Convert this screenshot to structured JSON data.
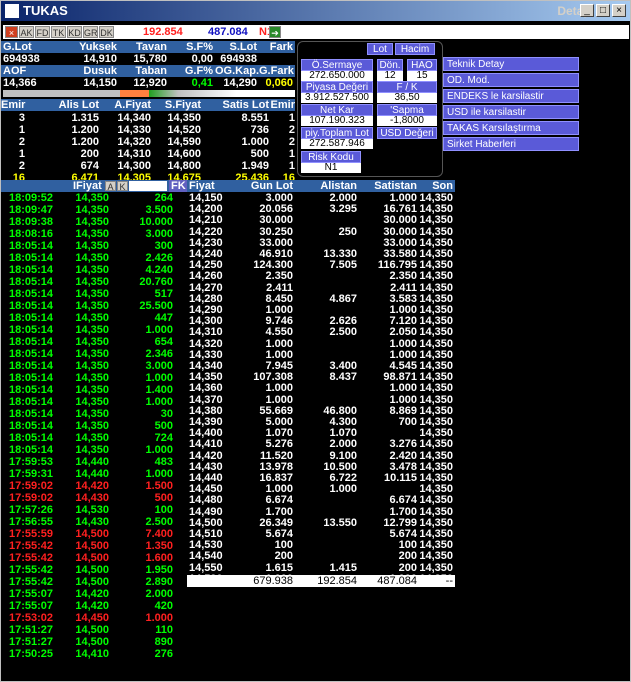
{
  "title": "TUKAS",
  "detay": "Detay",
  "toolbar": {
    "buttons": [
      "AK",
      "FD",
      "TK",
      "KD",
      "GR",
      "DK"
    ],
    "val1": "192.854",
    "val2": "487.084",
    "n1": "N1"
  },
  "summary": {
    "headers1": [
      "G.Lot",
      "Yuksek",
      "Tavan",
      "S.F%",
      "S.Lot",
      "Fark"
    ],
    "values1": [
      "694938",
      "14,910",
      "15,780",
      "0,00",
      "694938",
      ""
    ],
    "headers2": [
      "AOF",
      "Dusuk",
      "Taban",
      "G.F%",
      "OG.Kap.",
      "G.Fark"
    ],
    "values2": [
      "14,366",
      "14,150",
      "12,920",
      "0,41",
      "14,290",
      "0,060"
    ]
  },
  "depth": {
    "headers": [
      "Emir",
      "Alis Lot",
      "A.Fiyat",
      "S.Fiyat",
      "Satis Lot",
      "Emir"
    ],
    "rows": [
      [
        "3",
        "1.315",
        "14,340",
        "14,350",
        "8.551",
        "1"
      ],
      [
        "1",
        "1.200",
        "14,330",
        "14,520",
        "736",
        "2"
      ],
      [
        "2",
        "1.200",
        "14,320",
        "14,590",
        "1.000",
        "2"
      ],
      [
        "1",
        "200",
        "14,310",
        "14,600",
        "500",
        "1"
      ],
      [
        "2",
        "674",
        "14,300",
        "14,800",
        "1.949",
        "1"
      ]
    ],
    "totals": [
      "16",
      "6.471",
      "14,305",
      "14,675",
      "25.436",
      "16"
    ]
  },
  "panel": {
    "lot": "Lot",
    "hacim": "Hacim",
    "osermaye": "Ö.Sermaye",
    "osermaye_v": "272.650.000",
    "don": "Dön.",
    "don_v": "12",
    "hao": "HAO",
    "hao_v": "15",
    "piyasa": "Piyasa Değeri",
    "piyasa_v": "3.912.527.500",
    "fk": "F / K",
    "fk_v": "36,50",
    "netkar": "Net Kar",
    "netkar_v": "107.190.323",
    "sapma": "'Sapma",
    "sapma_v": "-1,8000",
    "piy": "piy.Toplam Lot",
    "piy_v": "272.587.946",
    "usd": "USD Değeri",
    "risk": "Risk Kodu",
    "risk_v": "N1"
  },
  "right_buttons": [
    "Teknik Detay",
    "OD. Mod.",
    "ENDEKS le karsilastir",
    "USD ile karsilastir",
    "TAKAS Karsılaştırma",
    "Sirket Haberleri"
  ],
  "trades": {
    "header": "IFiyat",
    "fk": "FK",
    "rows": [
      [
        "18:09:52",
        "14,350",
        "264",
        "g"
      ],
      [
        "18:09:47",
        "14,350",
        "3.500",
        "g"
      ],
      [
        "18:09:38",
        "14,350",
        "10.000",
        "g"
      ],
      [
        "18:08:16",
        "14,350",
        "3.000",
        "g"
      ],
      [
        "18:05:14",
        "14,350",
        "300",
        "g"
      ],
      [
        "18:05:14",
        "14,350",
        "2.426",
        "g"
      ],
      [
        "18:05:14",
        "14,350",
        "4.240",
        "g"
      ],
      [
        "18:05:14",
        "14,350",
        "20.760",
        "g"
      ],
      [
        "18:05:14",
        "14,350",
        "517",
        "g"
      ],
      [
        "18:05:14",
        "14,350",
        "25.500",
        "g"
      ],
      [
        "18:05:14",
        "14,350",
        "447",
        "g"
      ],
      [
        "18:05:14",
        "14,350",
        "1.000",
        "g"
      ],
      [
        "18:05:14",
        "14,350",
        "654",
        "g"
      ],
      [
        "18:05:14",
        "14,350",
        "2.346",
        "g"
      ],
      [
        "18:05:14",
        "14,350",
        "3.000",
        "g"
      ],
      [
        "18:05:14",
        "14,350",
        "1.000",
        "g"
      ],
      [
        "18:05:14",
        "14,350",
        "1.400",
        "g"
      ],
      [
        "18:05:14",
        "14,350",
        "1.000",
        "g"
      ],
      [
        "18:05:14",
        "14,350",
        "30",
        "g"
      ],
      [
        "18:05:14",
        "14,350",
        "500",
        "g"
      ],
      [
        "18:05:14",
        "14,350",
        "724",
        "g"
      ],
      [
        "18:05:14",
        "14,350",
        "1.000",
        "g"
      ],
      [
        "17:59:53",
        "14,440",
        "483",
        "g"
      ],
      [
        "17:59:31",
        "14,440",
        "1.000",
        "g"
      ],
      [
        "17:59:02",
        "14,420",
        "1.500",
        "r"
      ],
      [
        "17:59:02",
        "14,430",
        "500",
        "r"
      ],
      [
        "17:57:26",
        "14,530",
        "100",
        "g"
      ],
      [
        "17:56:55",
        "14,430",
        "2.500",
        "g"
      ],
      [
        "17:55:59",
        "14,500",
        "7.400",
        "r"
      ],
      [
        "17:55:42",
        "14,500",
        "1.350",
        "r"
      ],
      [
        "17:55:42",
        "14,500",
        "1.600",
        "r"
      ],
      [
        "17:55:42",
        "14,500",
        "1.950",
        "g"
      ],
      [
        "17:55:42",
        "14,500",
        "2.890",
        "g"
      ],
      [
        "17:55:07",
        "14,420",
        "2.000",
        "g"
      ],
      [
        "17:55:07",
        "14,420",
        "420",
        "g"
      ],
      [
        "17:53:02",
        "14,450",
        "1.000",
        "r"
      ],
      [
        "17:51:27",
        "14,500",
        "110",
        "g"
      ],
      [
        "17:51:27",
        "14,500",
        "890",
        "g"
      ],
      [
        "17:50:25",
        "14,410",
        "276",
        "g"
      ]
    ]
  },
  "dist": {
    "headers": [
      "Fiyat",
      "Gun Lot",
      "Alistan",
      "Satistan",
      "Son"
    ],
    "rows": [
      [
        "14,150",
        "3.000",
        "2.000",
        "1.000",
        "14,350"
      ],
      [
        "14,200",
        "20.056",
        "3.295",
        "16.761",
        "14,350"
      ],
      [
        "14,210",
        "30.000",
        "",
        "30.000",
        "14,350"
      ],
      [
        "14,220",
        "30.250",
        "250",
        "30.000",
        "14,350"
      ],
      [
        "14,230",
        "33.000",
        "",
        "33.000",
        "14,350"
      ],
      [
        "14,240",
        "46.910",
        "13.330",
        "33.580",
        "14,350"
      ],
      [
        "14,250",
        "124.300",
        "7.505",
        "116.795",
        "14,350"
      ],
      [
        "14,260",
        "2.350",
        "",
        "2.350",
        "14,350"
      ],
      [
        "14,270",
        "2.411",
        "",
        "2.411",
        "14,350"
      ],
      [
        "14,280",
        "8.450",
        "4.867",
        "3.583",
        "14,350"
      ],
      [
        "14,290",
        "1.000",
        "",
        "1.000",
        "14,350"
      ],
      [
        "14,300",
        "9.746",
        "2.626",
        "7.120",
        "14,350"
      ],
      [
        "14,310",
        "4.550",
        "2.500",
        "2.050",
        "14,350"
      ],
      [
        "14,320",
        "1.000",
        "",
        "1.000",
        "14,350"
      ],
      [
        "14,330",
        "1.000",
        "",
        "1.000",
        "14,350"
      ],
      [
        "14,340",
        "7.945",
        "3.400",
        "4.545",
        "14,350"
      ],
      [
        "14,350",
        "107.308",
        "8.437",
        "98.871",
        "14,350"
      ],
      [
        "14,360",
        "1.000",
        "",
        "1.000",
        "14,350"
      ],
      [
        "14,370",
        "1.000",
        "",
        "1.000",
        "14,350"
      ],
      [
        "14,380",
        "55.669",
        "46.800",
        "8.869",
        "14,350"
      ],
      [
        "14,390",
        "5.000",
        "4.300",
        "700",
        "14,350"
      ],
      [
        "14,400",
        "1.070",
        "1.070",
        "",
        "14,350"
      ],
      [
        "14,410",
        "5.276",
        "2.000",
        "3.276",
        "14,350"
      ],
      [
        "14,420",
        "11.520",
        "9.100",
        "2.420",
        "14,350"
      ],
      [
        "14,430",
        "13.978",
        "10.500",
        "3.478",
        "14,350"
      ],
      [
        "14,440",
        "16.837",
        "6.722",
        "10.115",
        "14,350"
      ],
      [
        "14,450",
        "1.000",
        "1.000",
        "",
        "14,350"
      ],
      [
        "14,480",
        "6.674",
        "",
        "6.674",
        "14,350"
      ],
      [
        "14,490",
        "1.700",
        "",
        "1.700",
        "14,350"
      ],
      [
        "14,500",
        "26.349",
        "13.550",
        "12.799",
        "14,350"
      ],
      [
        "14,510",
        "5.674",
        "",
        "5.674",
        "14,350"
      ],
      [
        "14,530",
        "100",
        "",
        "100",
        "14,350"
      ],
      [
        "14,540",
        "200",
        "",
        "200",
        "14,350"
      ],
      [
        "14,550",
        "1.615",
        "1.415",
        "200",
        "14,350"
      ],
      [
        "14,590",
        "1.000",
        "",
        "1.000",
        "14,350"
      ]
    ],
    "totals": [
      "",
      "679.938",
      "192.854",
      "487.084",
      "--"
    ]
  }
}
